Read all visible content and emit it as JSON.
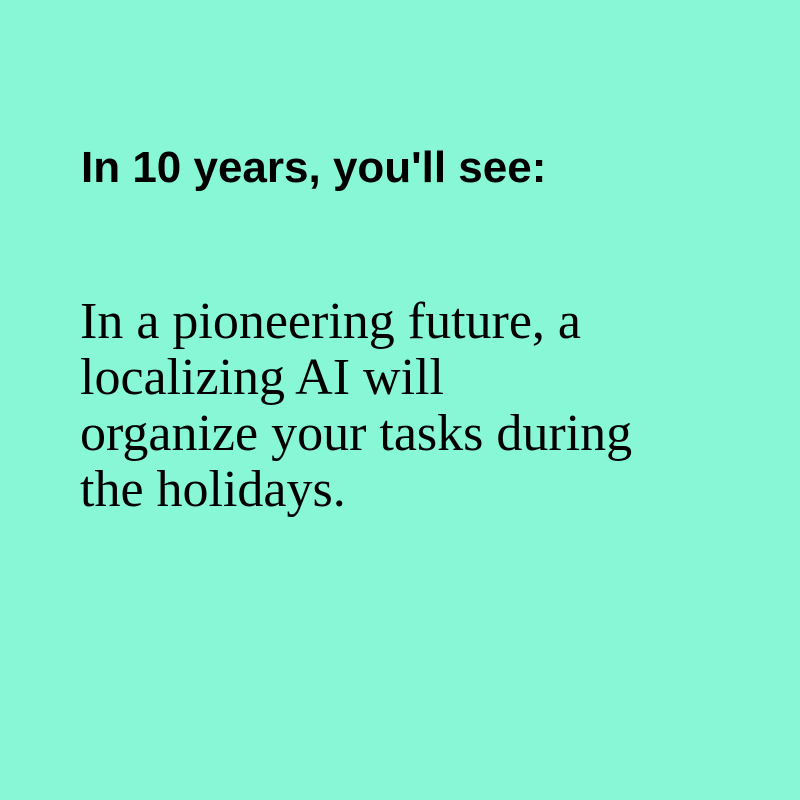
{
  "background_color": "#87f7d6",
  "text_color": "#000000",
  "headline": "In 10 years, you'll see:",
  "body_lines": [
    "In a pioneering future, a",
    "localizing AI will",
    "organize your tasks during",
    "the holidays."
  ]
}
